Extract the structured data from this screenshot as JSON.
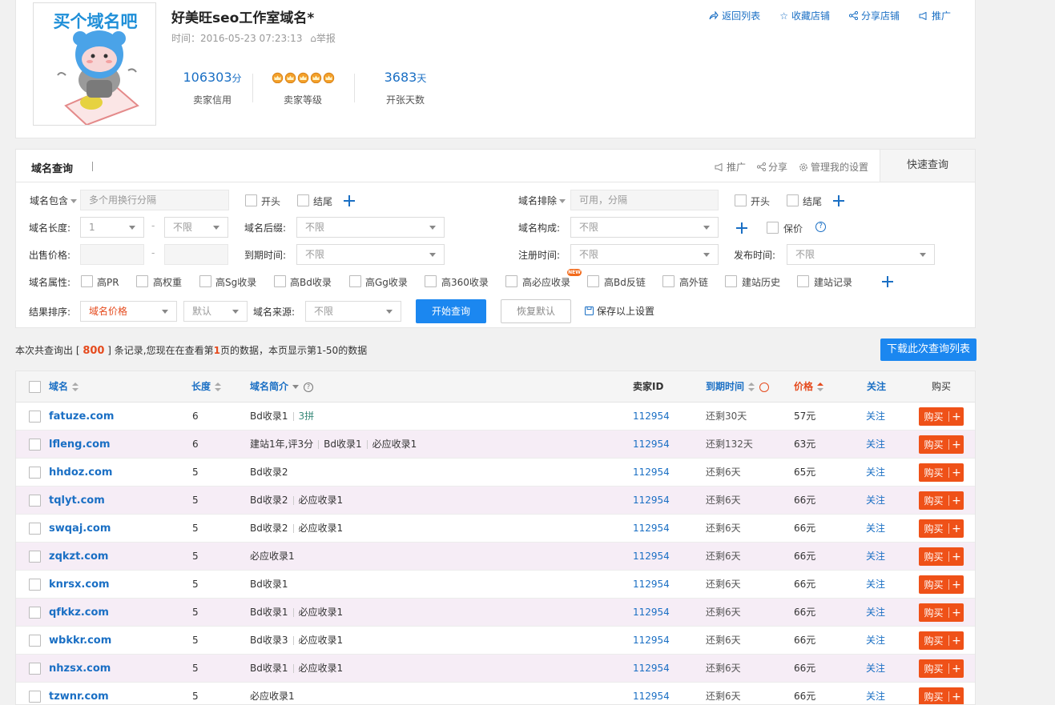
{
  "store": {
    "title": "好美旺seo工作室域名*",
    "time": "时间：2016-05-23 07:23:13",
    "report": "举报",
    "logo_text": "买个域名吧",
    "stats": [
      {
        "value": "106303",
        "unit": "分",
        "label": "卖家信用"
      },
      {
        "value": "",
        "unit": "",
        "label": "卖家等级"
      },
      {
        "value": "3683",
        "unit": "天",
        "label": "开张天数"
      }
    ],
    "level_crowns": 5,
    "links": [
      "返回列表",
      "收藏店铺",
      "分享店铺",
      "推广"
    ],
    "colors": {
      "accent": "#1a6fc4",
      "buy": "#ef5118",
      "primary_button": "#1b87f0"
    }
  },
  "panel": {
    "title": "域名查询",
    "tools": [
      "推广",
      "分享",
      "管理我的设置"
    ],
    "quick_tab": "快速查询",
    "include_label": "域名包含",
    "include_placeholder": "多个用换行分隔",
    "head_label": "开头",
    "tail_label": "结尾",
    "exclude_label": "域名排除",
    "exclude_placeholder": "可用，分隔",
    "length_label": "域名长度:",
    "length_min": "1",
    "length_max": "不限",
    "suffix_label": "域名后缀:",
    "suffix_value": "不限",
    "compose_label": "域名构成:",
    "compose_value": "不限",
    "keep_price_label": "保价",
    "price_label": "出售价格:",
    "expire_label": "到期时间:",
    "expire_value": "不限",
    "register_label": "注册时间:",
    "register_value": "不限",
    "publish_label": "发布时间:",
    "publish_value": "不限",
    "attr_label": "域名属性:",
    "attrs": [
      "高PR",
      "高权重",
      "高Sg收录",
      "高Bd收录",
      "高Gg收录",
      "高360收录",
      "高必应收录",
      "高Bd反链",
      "高外链",
      "建站历史",
      "建站记录"
    ],
    "new_badge": "NEW",
    "sort_label": "结果排序:",
    "sort_value": "域名价格",
    "order_value": "默认",
    "source_label": "域名来源:",
    "source_value": "不限",
    "search_button": "开始查询",
    "reset_button": "恢复默认",
    "save_link": "保存以上设置"
  },
  "summary": {
    "pre": "本次共查询出 [ ",
    "count": "800",
    "mid": " ] 条记录,您现在在查看第",
    "page": "1",
    "post": "页的数据，本页显示第1-50的数据",
    "download_button": "下载此次查询列表"
  },
  "table": {
    "headers": {
      "domain": "域名",
      "length": "长度",
      "desc": "域名简介",
      "seller": "卖家ID",
      "expire": "到期时间",
      "price": "价格",
      "follow": "关注",
      "buy": "购买"
    },
    "buy_label": "购买",
    "buy_plus": "+",
    "rows": [
      {
        "domain": "fatuze.com",
        "length": "6",
        "desc": [
          "Bd收录1"
        ],
        "tag": "3拼",
        "seller": "112954",
        "expire": "还剩30天",
        "price": "57元",
        "follow": "关注"
      },
      {
        "domain": "lfleng.com",
        "length": "6",
        "desc": [
          "建站1年,评3分",
          "Bd收录1",
          "必应收录1"
        ],
        "tag": "",
        "seller": "112954",
        "expire": "还剩132天",
        "price": "63元",
        "follow": "关注"
      },
      {
        "domain": "hhdoz.com",
        "length": "5",
        "desc": [
          "Bd收录2"
        ],
        "tag": "",
        "seller": "112954",
        "expire": "还剩6天",
        "price": "65元",
        "follow": "关注"
      },
      {
        "domain": "tqlyt.com",
        "length": "5",
        "desc": [
          "Bd收录2",
          "必应收录1"
        ],
        "tag": "",
        "seller": "112954",
        "expire": "还剩6天",
        "price": "66元",
        "follow": "关注"
      },
      {
        "domain": "swqaj.com",
        "length": "5",
        "desc": [
          "Bd收录2",
          "必应收录1"
        ],
        "tag": "",
        "seller": "112954",
        "expire": "还剩6天",
        "price": "66元",
        "follow": "关注"
      },
      {
        "domain": "zqkzt.com",
        "length": "5",
        "desc": [
          "必应收录1"
        ],
        "tag": "",
        "seller": "112954",
        "expire": "还剩6天",
        "price": "66元",
        "follow": "关注"
      },
      {
        "domain": "knrsx.com",
        "length": "5",
        "desc": [
          "Bd收录1"
        ],
        "tag": "",
        "seller": "112954",
        "expire": "还剩6天",
        "price": "66元",
        "follow": "关注"
      },
      {
        "domain": "qfkkz.com",
        "length": "5",
        "desc": [
          "Bd收录1",
          "必应收录1"
        ],
        "tag": "",
        "seller": "112954",
        "expire": "还剩6天",
        "price": "66元",
        "follow": "关注"
      },
      {
        "domain": "wbkkr.com",
        "length": "5",
        "desc": [
          "Bd收录3",
          "必应收录1"
        ],
        "tag": "",
        "seller": "112954",
        "expire": "还剩6天",
        "price": "66元",
        "follow": "关注"
      },
      {
        "domain": "nhzsx.com",
        "length": "5",
        "desc": [
          "Bd收录1",
          "必应收录1"
        ],
        "tag": "",
        "seller": "112954",
        "expire": "还剩6天",
        "price": "66元",
        "follow": "关注"
      },
      {
        "domain": "tzwnr.com",
        "length": "5",
        "desc": [
          "必应收录1"
        ],
        "tag": "",
        "seller": "112954",
        "expire": "还剩6天",
        "price": "66元",
        "follow": "关注"
      }
    ]
  }
}
